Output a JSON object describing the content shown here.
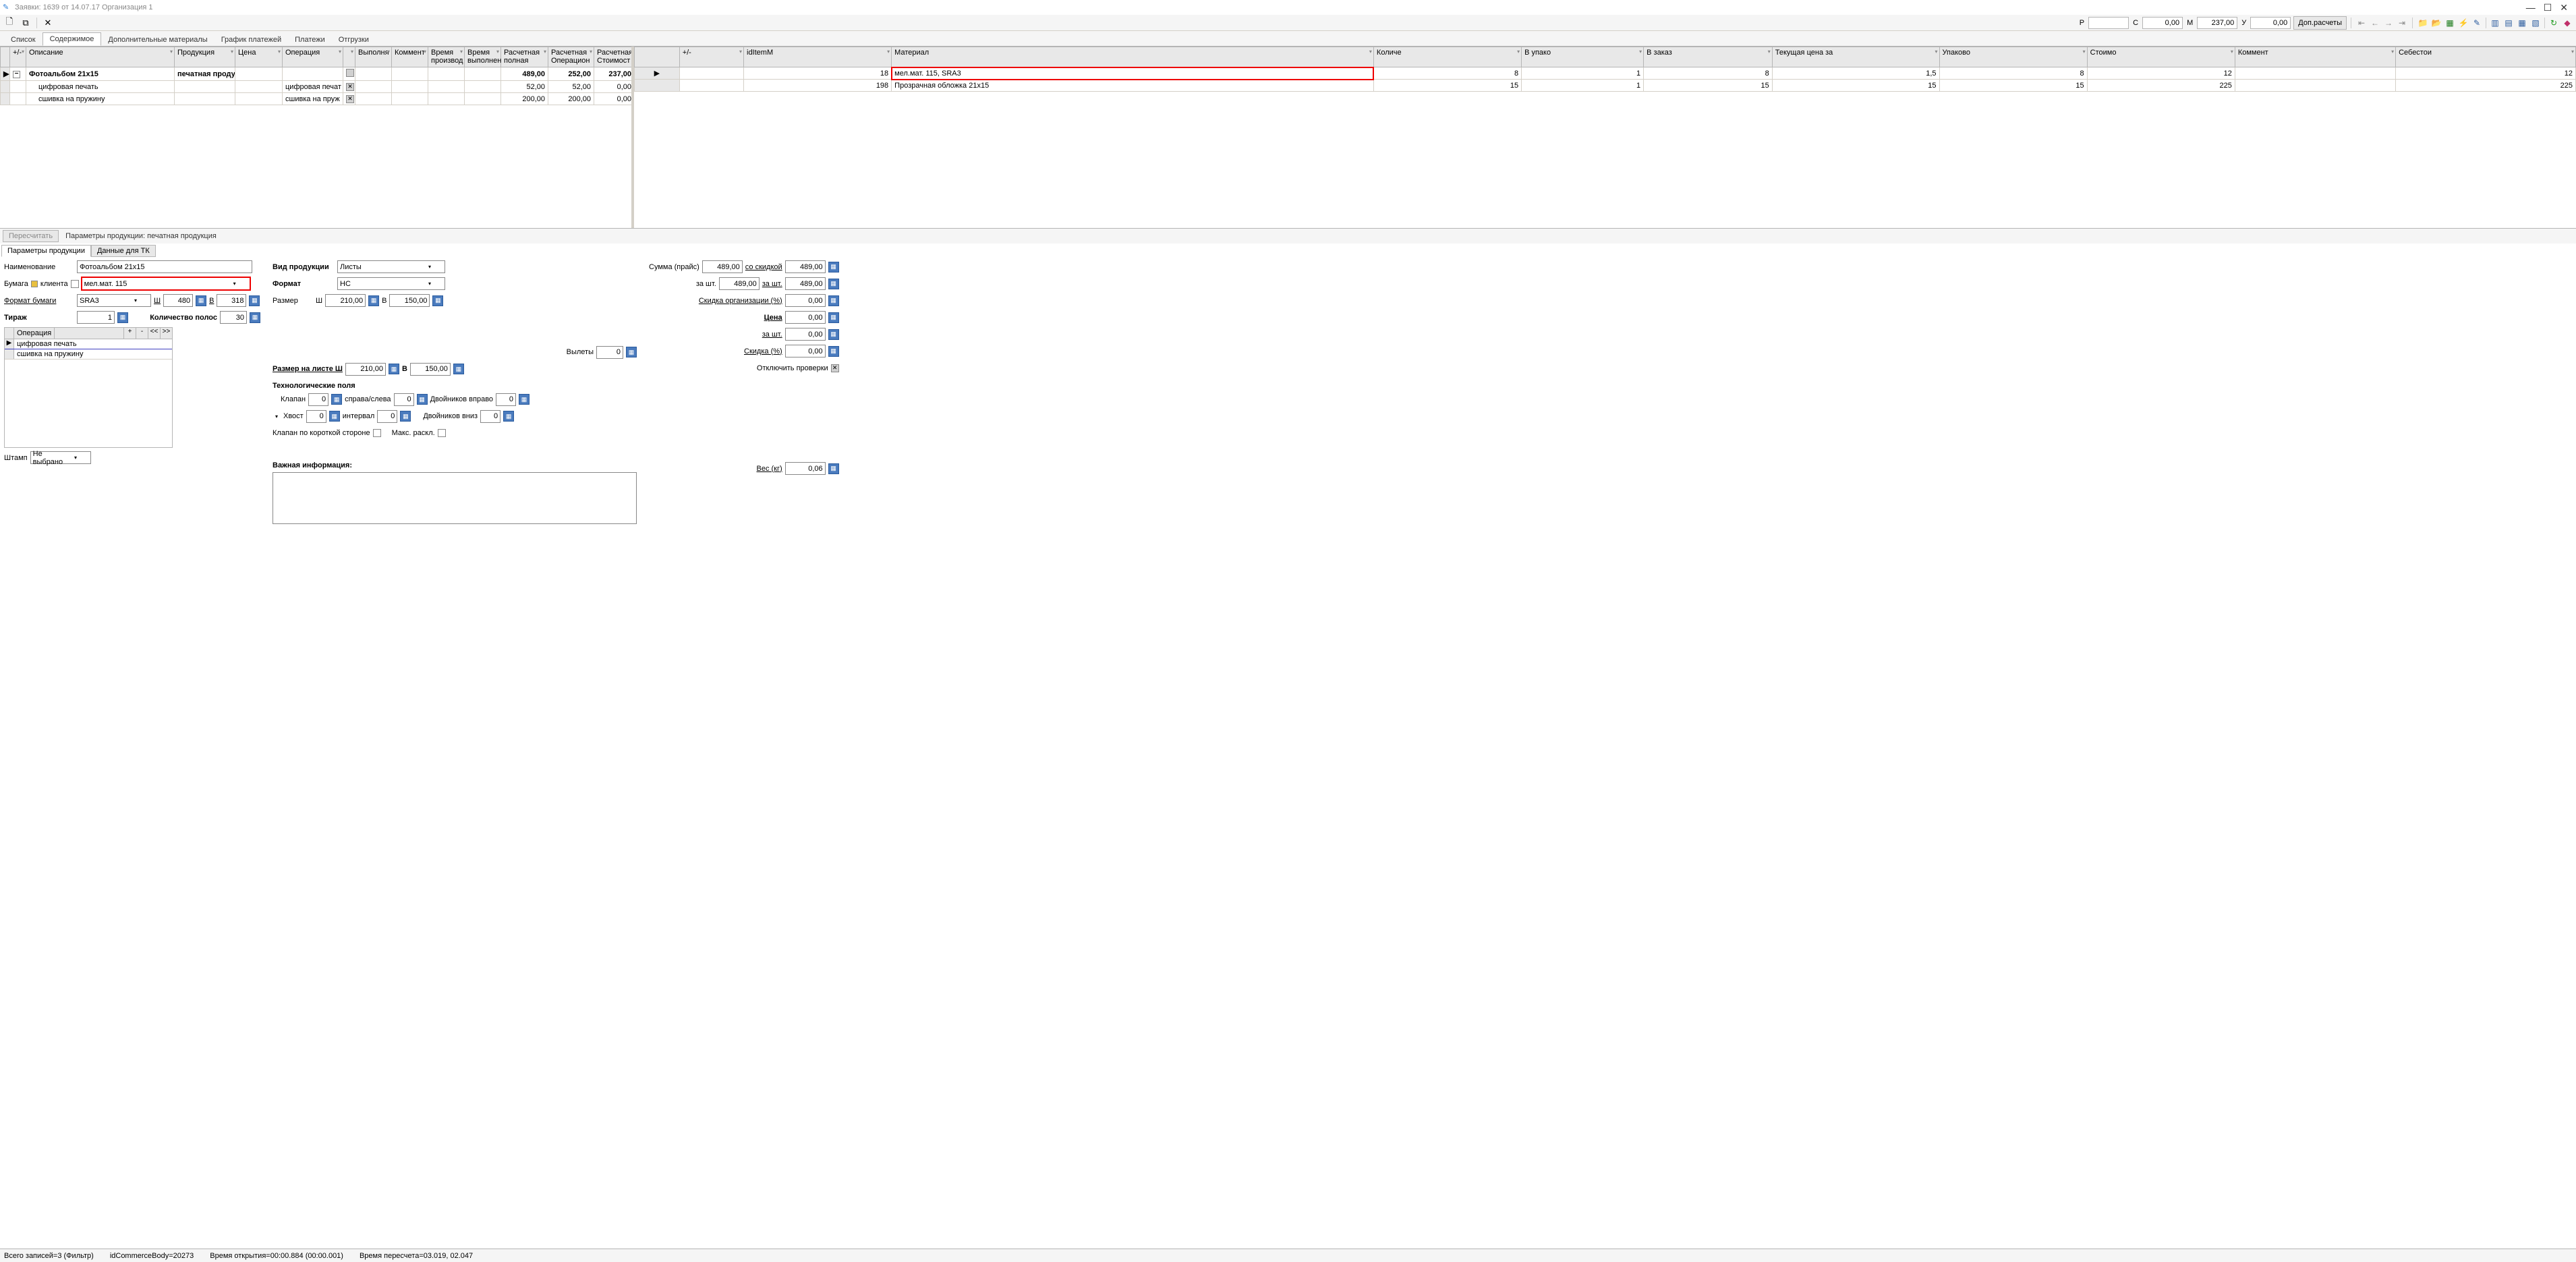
{
  "title": "Заявки: 1639 от 14.07.17  Организация 1",
  "toolbar_fields": {
    "R": {
      "label": "Р",
      "value": ""
    },
    "S": {
      "label": "С",
      "value": "0,00"
    },
    "M": {
      "label": "М",
      "value": "237,00"
    },
    "U": {
      "label": "У",
      "value": "0,00"
    },
    "extra_btn": "Доп.расчеты"
  },
  "main_tabs": [
    "Список",
    "Содержимое",
    "Дополнительные материалы",
    "График платежей",
    "Платежи",
    "Отгрузки"
  ],
  "main_tab_active": 1,
  "grid_left": {
    "columns": [
      "+/-",
      "Описание",
      "Продукция",
      "Цена",
      "Операция",
      "",
      "Выполня",
      "Коммент",
      "Время производ",
      "Время выполнен",
      "Расчетная полная",
      "Расчетная Операцион",
      "Расчетная Стоимост"
    ],
    "rows": [
      {
        "mark": "▶",
        "expand": "−",
        "bold": true,
        "desc": "Фотоальбом 21х15",
        "prod": "печатная продук",
        "price": "",
        "op": "",
        "chk": "empty",
        "vyp": "",
        "comm": "",
        "t1": "",
        "t2": "",
        "r1": "489,00",
        "r2": "252,00",
        "r3": "237,00"
      },
      {
        "mark": "",
        "expand": "",
        "bold": false,
        "desc": "цифровая печать",
        "prod": "",
        "price": "",
        "op": "цифровая печат",
        "chk": "checked",
        "vyp": "",
        "comm": "",
        "t1": "",
        "t2": "",
        "r1": "52,00",
        "r2": "52,00",
        "r3": "0,00"
      },
      {
        "mark": "",
        "expand": "",
        "bold": false,
        "desc": "сшивка на пружину",
        "prod": "",
        "price": "",
        "op": "сшивка на пруж",
        "chk": "checked",
        "vyp": "",
        "comm": "",
        "t1": "",
        "t2": "",
        "r1": "200,00",
        "r2": "200,00",
        "r3": "0,00"
      }
    ]
  },
  "grid_right": {
    "columns": [
      "+/-",
      "idItemM",
      "Материал",
      "Количе",
      "В упако",
      "В заказ",
      "Текущая цена за",
      "Упаково",
      "Стоимо",
      "Коммент",
      "Себестои"
    ],
    "rows": [
      {
        "mark": "▶",
        "redbox": true,
        "id": "18",
        "mat": "мел.мат. 115, SRA3",
        "q": "8",
        "vu": "1",
        "vz": "8",
        "tc": "1,5",
        "up": "8",
        "st": "12",
        "com": "",
        "seb": "12"
      },
      {
        "mark": "",
        "redbox": false,
        "id": "198",
        "mat": "Прозрачная обложка 21х15",
        "q": "15",
        "vu": "1",
        "vz": "15",
        "tc": "15",
        "up": "15",
        "st": "225",
        "com": "",
        "seb": "225"
      }
    ]
  },
  "mid": {
    "recalc_btn": "Пересчитать",
    "params_label": "Параметры продукции: печатная продукция",
    "subtabs": [
      "Параметры продукции",
      "Данные для ТК"
    ],
    "subtab_active": 0
  },
  "form": {
    "name_lbl": "Наименование",
    "name_val": "Фотоальбом 21х15",
    "paper_lbl": "Бумага",
    "client_lbl": "клиента",
    "paper_val": "мел.мат. 115",
    "paper_format_lbl": "Формат бумаги",
    "paper_format_val": "SRA3",
    "W_lbl": "Ш",
    "W_val": "480",
    "H_lbl": "В",
    "H_val": "318",
    "tirazh_lbl": "Тираж",
    "tirazh_val": "1",
    "polos_lbl": "Количество полос",
    "polos_val": "30",
    "ops_header": "Операция",
    "ops_btns": [
      "+",
      "-",
      "<<",
      ">>"
    ],
    "ops": [
      "цифровая печать",
      "сшивка на пружину"
    ],
    "stamp_lbl": "Штамп",
    "stamp_val": "Не выбрано",
    "vid_lbl": "Вид продукции",
    "vid_val": "Листы",
    "format_lbl": "Формат",
    "format_val": "НС",
    "size_lbl": "Размер",
    "size_w": "210,00",
    "size_h": "150,00",
    "vylety_lbl": "Вылеты",
    "vylety_val": "0",
    "sheet_size_lbl": "Размер на листе Ш",
    "sheet_w": "210,00",
    "sheet_h_lbl": "В",
    "sheet_h": "150,00",
    "tech_lbl": "Технологические поля",
    "klapan_lbl": "Клапан",
    "klapan_val": "0",
    "spravasleva_lbl": "справа/слева",
    "spravasleva_val": "0",
    "dvoyn_right_lbl": "Двойников вправо",
    "dvoyn_right_val": "0",
    "hvost_lbl": "Хвост",
    "hvost_val": "0",
    "interval_lbl": "интервал",
    "interval_val": "0",
    "dvoyn_down_lbl": "Двойников вниз",
    "dvoyn_down_val": "0",
    "klapan_short_lbl": "Клапан по короткой стороне",
    "max_raskl_lbl": "Макс. раскл.",
    "important_lbl": "Важная информация:",
    "summa_lbl": "Сумма (прайс)",
    "summa_val": "489,00",
    "so_skidkoy_lbl": "со скидкой",
    "so_skidkoy_val": "489,00",
    "za_sht_lbl": "за шт.",
    "za_sht_val": "489,00",
    "za_sht2_val": "489,00",
    "skidka_org_lbl": "Скидка организации (%)",
    "skidka_org_val": "0,00",
    "cena_lbl": "Цена",
    "cena_val": "0,00",
    "cena_sht_lbl": "за шт.",
    "cena_sht_val": "0,00",
    "skidka_pct_lbl": "Скидка (%)",
    "skidka_pct_val": "0,00",
    "off_checks_lbl": "Отключить проверки",
    "weight_lbl": "Вес (кг)",
    "weight_val": "0,06"
  },
  "statusbar": {
    "records": "Всего записей=3 (Фильтр)",
    "idbody": "idCommerceBody=20273",
    "topen": "Время открытия=00:00.884 (00:00.001)",
    "trecalc": "Время пересчета=03.019, 02.047"
  }
}
